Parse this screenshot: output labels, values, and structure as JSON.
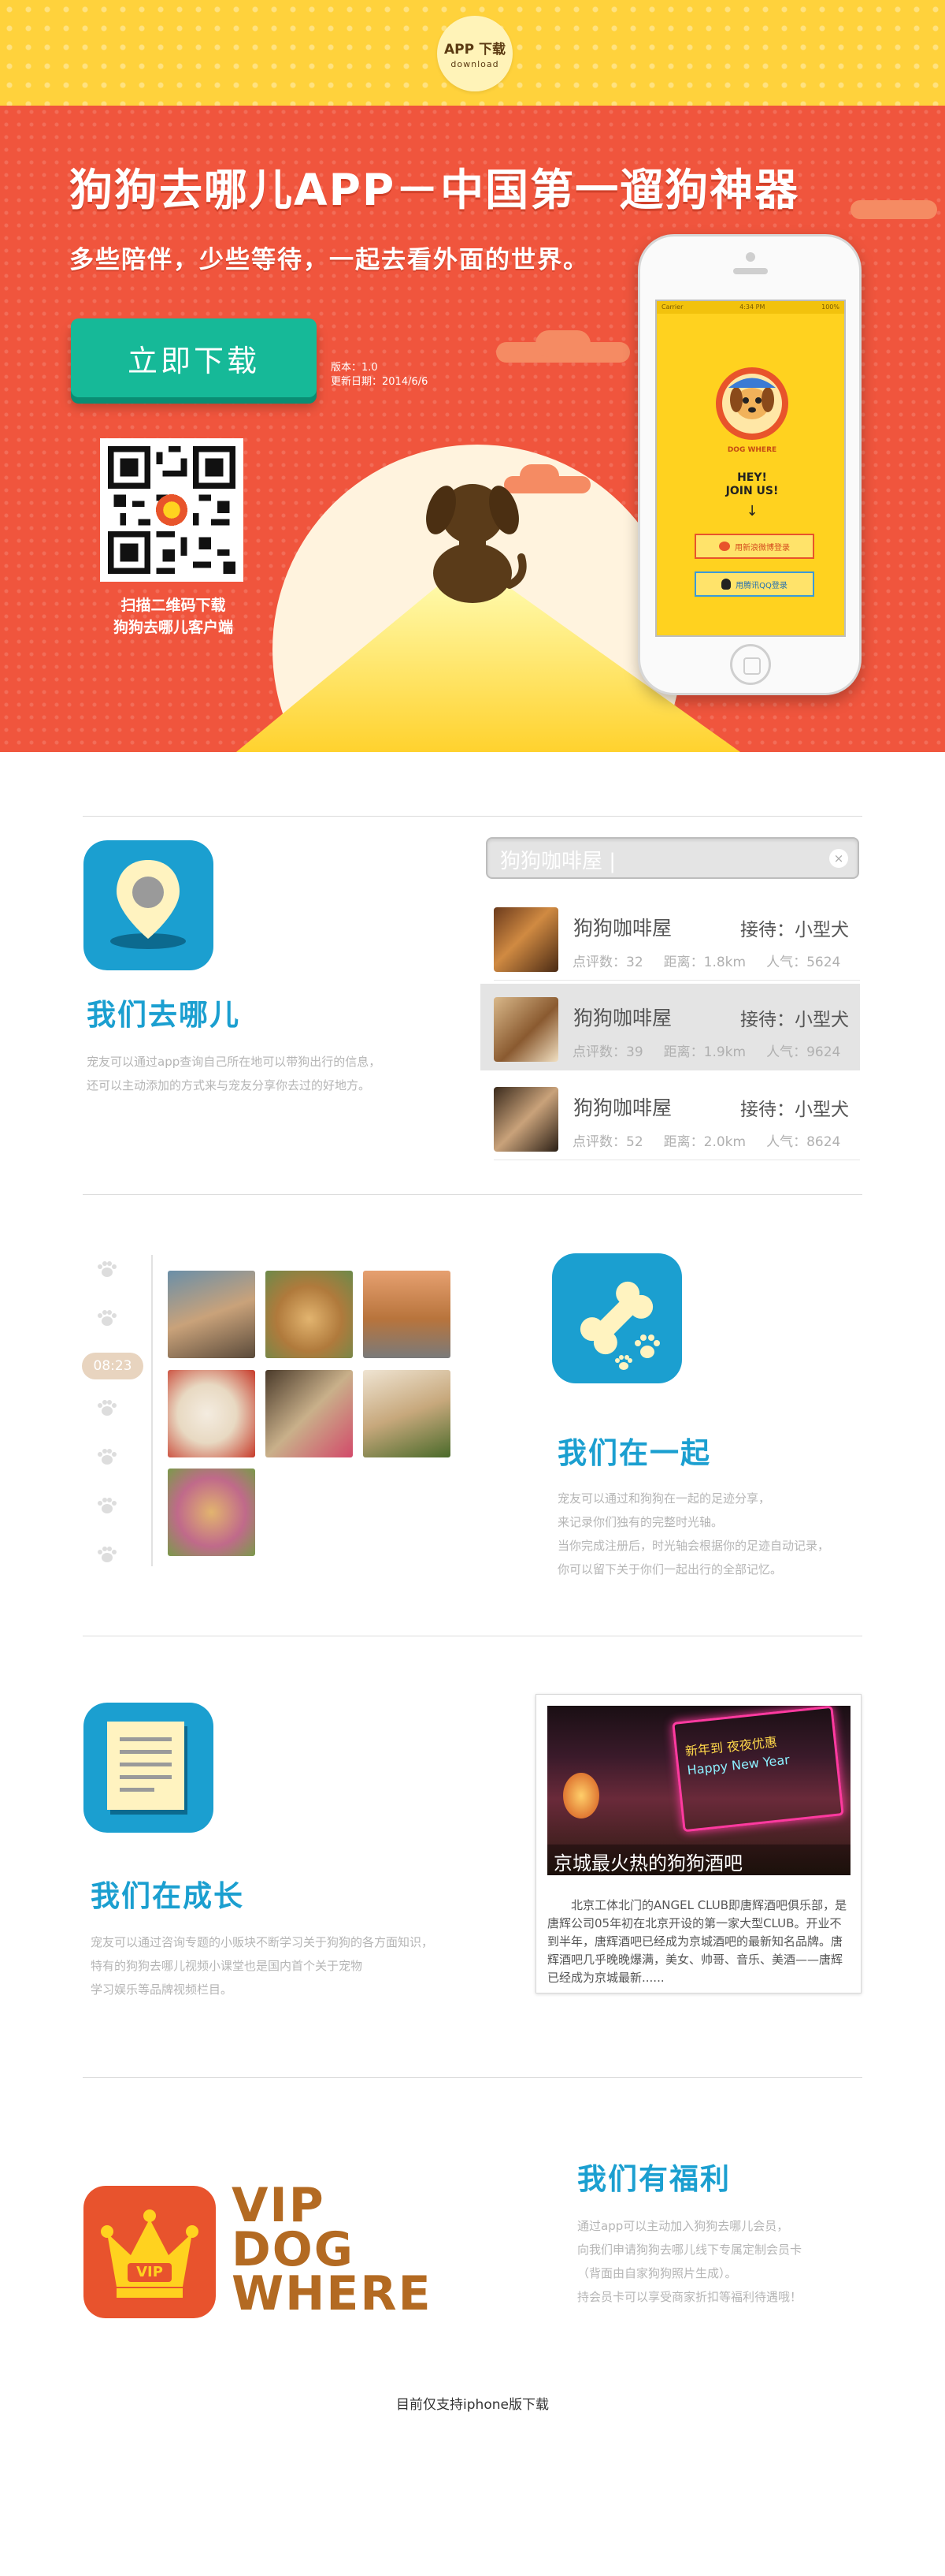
{
  "header": {
    "badge_line1": "APP 下载",
    "badge_line2": "download"
  },
  "hero": {
    "title": "狗狗去哪儿APP－中国第一遛狗神器",
    "subtitle": "多些陪伴，少些等待，一起去看外面的世界。",
    "download_label": "立即下载",
    "version": "版本：1.0",
    "update_date": "更新日期：2014/6/6",
    "qr_caption_line1": "扫描二维码下载",
    "qr_caption_line2": "狗狗去哪儿客户端"
  },
  "phone": {
    "carrier": "Carrier",
    "time": "4:34 PM",
    "battery": "100%",
    "logo_text": "DOG WHERE",
    "hey_line1": "HEY!",
    "hey_line2": "JOIN US!",
    "arrow": "↓",
    "weibo_login": "用新浪微博登录",
    "qq_login": "用腾讯QQ登录"
  },
  "section_where": {
    "title": "我们去哪儿",
    "desc_line1": "宠友可以通过app查询自己所在地可以带狗出行的信息，",
    "desc_line2": "还可以主动添加的方式来与宠友分享你去过的好地方。",
    "search_value": "狗狗咖啡屋 |",
    "clear_icon": "×",
    "places": [
      {
        "name": "狗狗咖啡屋",
        "accept": "接待：小型犬",
        "reviews": "点评数：32",
        "distance": "距离：1.8km",
        "popularity": "人气：5624"
      },
      {
        "name": "狗狗咖啡屋",
        "accept": "接待：小型犬",
        "reviews": "点评数：39",
        "distance": "距离：1.9km",
        "popularity": "人气：9624"
      },
      {
        "name": "狗狗咖啡屋",
        "accept": "接待：小型犬",
        "reviews": "点评数：52",
        "distance": "距离：2.0km",
        "popularity": "人气：8624"
      }
    ]
  },
  "section_together": {
    "time_label": "08:23",
    "title": "我们在一起",
    "desc_line1": "宠友可以通过和狗狗在一起的足迹分享，",
    "desc_line2": "来记录你们独有的完整时光轴。",
    "desc_line3": "当你完成注册后，时光轴会根据你的足迹自动记录，",
    "desc_line4": "你可以留下关于你们一起出行的全部记忆。"
  },
  "section_grow": {
    "title": "我们在成长",
    "desc_line1": "宠友可以通过咨询专题的小贩块不断学习关于狗狗的各方面知识，",
    "desc_line2": "特有的狗狗去哪儿视频小课堂也是国内首个关于宠物",
    "desc_line3": "学习娱乐等品牌视频栏目。",
    "card_caption": "京城最火热的狗狗酒吧",
    "card_body": "北京工体北门的ANGEL CLUB即唐辉酒吧俱乐部，是唐辉公司05年初在北京开设的第一家大型CLUB。开业不到半年，唐辉酒吧已经成为京城酒吧的最新知名品牌。唐辉酒吧几乎晚晚爆满，美女、帅哥、音乐、美酒——唐辉已经成为京城最新......",
    "neon_line1": "新年到 夜夜优惠",
    "neon_line2": "Happy New Year"
  },
  "section_vip": {
    "title": "我们有福利",
    "desc_line1": "通过app可以主动加入狗狗去哪儿会员，",
    "desc_line2": "向我们申请狗狗去哪儿线下专属定制会员卡",
    "desc_line3": "（背面由自家狗狗照片生成）。",
    "desc_line4": "持会员卡可以享受商家折扣等福利待遇哦！",
    "badge_text": "VIP",
    "word1": "VIP",
    "word2": "DOG",
    "word3": "WHERE"
  },
  "footer": {
    "note": "目前仅支持iphone版下载"
  },
  "colors": {
    "yellow": "#ffd23c",
    "hero_red": "#f0553d",
    "green": "#16b998",
    "blue": "#1b9fd0",
    "brown": "#b36a22"
  }
}
